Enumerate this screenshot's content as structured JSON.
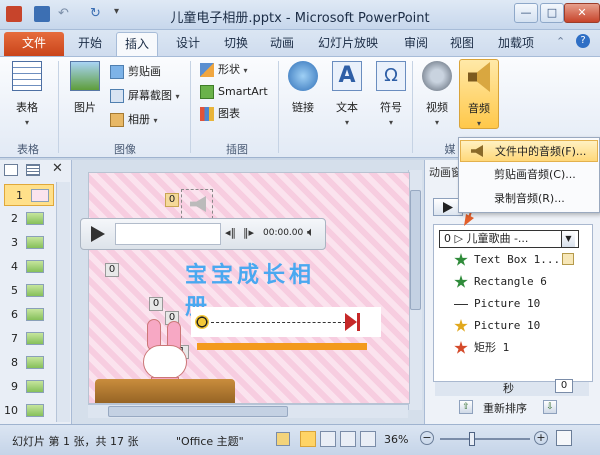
{
  "window": {
    "title": "儿童电子相册.pptx - Microsoft PowerPoint"
  },
  "tabs": [
    {
      "label": "文件"
    },
    {
      "label": "开始"
    },
    {
      "label": "插入"
    },
    {
      "label": "设计"
    },
    {
      "label": "切换"
    },
    {
      "label": "动画"
    },
    {
      "label": "幻灯片放映"
    },
    {
      "label": "审阅"
    },
    {
      "label": "视图"
    },
    {
      "label": "加载项"
    }
  ],
  "ribbon": {
    "table": {
      "label": "表格",
      "group": "表格"
    },
    "picture": {
      "label": "图片"
    },
    "clipart": {
      "label": "剪贴画"
    },
    "screenshot": {
      "label": "屏幕截图"
    },
    "album": {
      "label": "相册"
    },
    "images_group": "图像",
    "shapes": {
      "label": "形状"
    },
    "smartart": {
      "label": "SmartArt"
    },
    "chart": {
      "label": "图表"
    },
    "illustrations_group": "插图",
    "link": {
      "label": "链接"
    },
    "text": {
      "label": "文本"
    },
    "symbol": {
      "label": "符号"
    },
    "video": {
      "label": "视频"
    },
    "audio": {
      "label": "音频"
    },
    "media_group": "媒"
  },
  "audio_menu": [
    {
      "label": "文件中的音频(F)..."
    },
    {
      "label": "剪贴画音频(C)..."
    },
    {
      "label": "录制音频(R)..."
    }
  ],
  "slides": {
    "numbers": [
      "1",
      "2",
      "3",
      "4",
      "5",
      "6",
      "7",
      "8",
      "9",
      "10"
    ],
    "selected": 1
  },
  "slide": {
    "title": "宝宝成长相册",
    "player_time": "00:00.00",
    "tag_top": "0",
    "tag_left": "0",
    "tag_mid1": "0",
    "tag_mid2": "0",
    "tag_bottom": "1"
  },
  "anim_pane": {
    "title": "动画窗",
    "selected_item": "0 ▷ 儿童歌曲 -...",
    "items": [
      {
        "label": "Text Box 1..."
      },
      {
        "label": "Rectangle 6"
      },
      {
        "label": "Picture 10"
      },
      {
        "label": "Picture 10"
      },
      {
        "label": "矩形 1"
      }
    ],
    "seconds_label": "秒",
    "seconds_value": "0",
    "reorder_label": "重新排序"
  },
  "status": {
    "slide_info": "幻灯片 第 1 张，共 17 张",
    "theme": "\"Office 主题\"",
    "zoom": "36%",
    "zoom_level": 0.36
  },
  "colors": {
    "accent_orange": "#e35f2a",
    "slide_title_blue": "#4aa8f0",
    "progress_orange": "#f39a1d"
  }
}
